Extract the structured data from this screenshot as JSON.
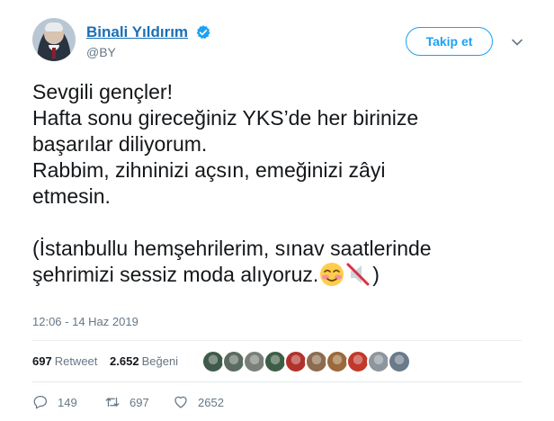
{
  "user": {
    "display_name": "Binali Yıldırım",
    "handle": "@BY",
    "verified": true
  },
  "follow_button_label": "Takip et",
  "tweet": {
    "lines": [
      "Sevgili gençler!",
      "Hafta sonu gireceğiniz YKS’de her birinize",
      "başarılar diliyorum.",
      "Rabbim, zihninizi açsın, emeğinizi zâyi",
      "etmesin.",
      "",
      "(İstanbullu hemşehrilerim, sınav saatlerinde"
    ],
    "last_line_text": "şehrimizi sessiz moda alıyoruz.",
    "last_line_close": ")",
    "emojis": [
      "smiling-face-with-blush-emoji",
      "muted-speaker-emoji"
    ]
  },
  "timestamp": "12:06 - 14 Haz 2019",
  "stats": {
    "retweet_count": "697",
    "retweet_label": "Retweet",
    "like_count": "2.652",
    "like_label": "Beğeni"
  },
  "likers": [
    "#3f5a4a",
    "#5b6b60",
    "#7a7f78",
    "#3e5d46",
    "#b1322c",
    "#8c6b4f",
    "#9a6a3a",
    "#c0392b",
    "#8d959d",
    "#6b7a8a"
  ],
  "actions": {
    "reply_count": "149",
    "retweet_count": "697",
    "like_count": "2652"
  },
  "colors": {
    "link_blue": "#1da1f2",
    "name_blue": "#1a6fb5",
    "muted_gray": "#657786",
    "text": "#14171a"
  }
}
